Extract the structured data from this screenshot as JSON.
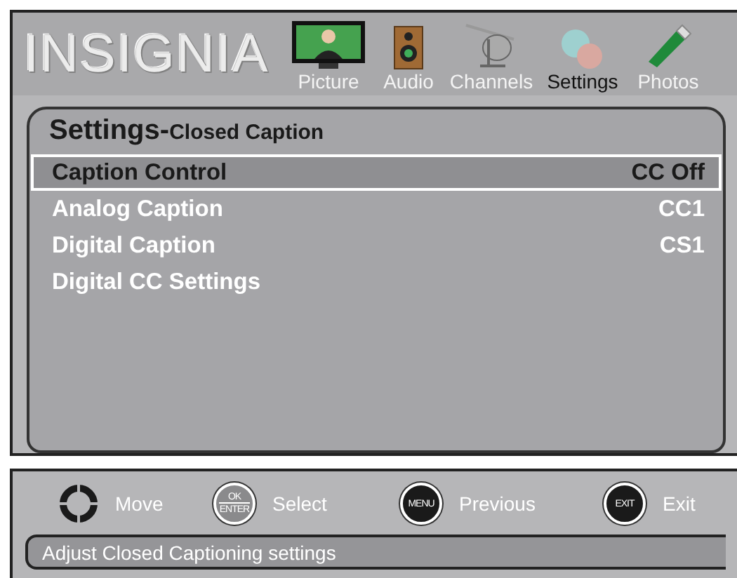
{
  "brand": {
    "logo": "INSIGNIA"
  },
  "nav_tabs": [
    {
      "label": "Picture",
      "kind": "tv",
      "selected": false
    },
    {
      "label": "Audio",
      "kind": "speaker",
      "selected": false
    },
    {
      "label": "Channels",
      "kind": "antenna",
      "selected": false
    },
    {
      "label": "Settings",
      "kind": "gears",
      "selected": true
    },
    {
      "label": "Photos",
      "kind": "usb",
      "selected": false
    }
  ],
  "panel": {
    "title": "Settings-",
    "subtitle": "Closed Caption",
    "items": [
      {
        "label": "Caption Control",
        "value": "CC Off",
        "selected": true
      },
      {
        "label": "Analog Caption",
        "value": "CC1",
        "selected": false
      },
      {
        "label": "Digital Caption",
        "value": "CS1",
        "selected": false
      },
      {
        "label": "Digital CC Settings",
        "selected": false
      }
    ]
  },
  "hints": [
    {
      "kind": "dpad",
      "action": "Move"
    },
    {
      "kind": "ok",
      "keys": [
        "OK",
        "ENTER"
      ],
      "action": "Select"
    },
    {
      "kind": "round",
      "keys": [
        "MENU"
      ],
      "action": "Previous"
    },
    {
      "kind": "round",
      "keys": [
        "EXIT"
      ],
      "action": "Exit"
    }
  ],
  "status_bar": "Adjust Closed Captioning settings"
}
